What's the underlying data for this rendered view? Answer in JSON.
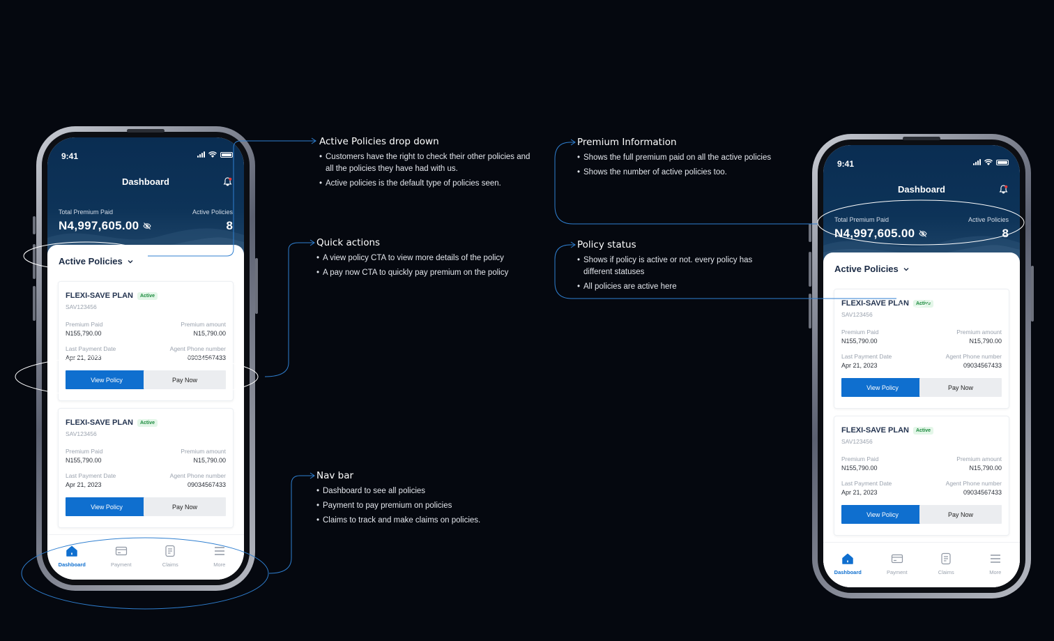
{
  "phone": {
    "status_time": "9:41",
    "title": "Dashboard",
    "total_premium_label": "Total Premium Paid",
    "total_premium_value": "N4,997,605.00",
    "active_policies_label": "Active Policies",
    "active_policies_count": "8",
    "dropdown_label": "Active Policies",
    "policies": [
      {
        "name": "FLEXI-SAVE PLAN",
        "status": "Active",
        "code": "SAV123456",
        "premium_paid_label": "Premium Paid",
        "premium_paid": "N155,790.00",
        "premium_amount_label": "Premium amount",
        "premium_amount": "N15,790.00",
        "last_payment_label": "Last Payment Date",
        "last_payment": "Apr 21, 2023",
        "agent_phone_label": "Agent Phone number",
        "agent_phone": "09034567433",
        "view_label": "View Policy",
        "pay_label": "Pay Now"
      },
      {
        "name": "FLEXI-SAVE PLAN",
        "status": "Active",
        "code": "SAV123456",
        "premium_paid_label": "Premium Paid",
        "premium_paid": "N155,790.00",
        "premium_amount_label": "Premium amount",
        "premium_amount": "N15,790.00",
        "last_payment_label": "Last Payment Date",
        "last_payment": "Apr 21, 2023",
        "agent_phone_label": "Agent Phone number",
        "agent_phone": "09034567433",
        "view_label": "View Policy",
        "pay_label": "Pay Now"
      }
    ],
    "nav": [
      {
        "label": "Dashboard",
        "icon": "home-icon",
        "active": true
      },
      {
        "label": "Payment",
        "icon": "card-icon",
        "active": false
      },
      {
        "label": "Claims",
        "icon": "document-icon",
        "active": false
      },
      {
        "label": "More",
        "icon": "menu-icon",
        "active": false
      }
    ]
  },
  "annotations": {
    "dropdown": {
      "title": "Active Policies drop down",
      "points": [
        "Customers have the right to check their other policies and all the policies they have had with us.",
        "Active policies is the default type of policies seen."
      ]
    },
    "quick_actions": {
      "title": "Quick actions",
      "points": [
        "A view policy CTA to view more details of the policy",
        "A pay now CTA to quickly pay premium on the policy"
      ]
    },
    "nav_bar": {
      "title": "Nav bar",
      "points": [
        "Dashboard to see all policies",
        "Payment to pay premium on policies",
        "Claims to track and make claims on policies."
      ]
    },
    "premium_info": {
      "title": "Premium Information",
      "points": [
        "Shows the full premium paid on all the active policies",
        "Shows the number of active policies too."
      ]
    },
    "policy_status": {
      "title": "Policy status",
      "points": [
        "Shows if policy is active or not. every policy has different statuses",
        "All policies are active here"
      ]
    }
  },
  "colors": {
    "background": "#05080f",
    "header_navy": "#0a2d52",
    "primary_blue": "#0f6fcf",
    "annotation_line": "#2f7fd0",
    "active_green": "#1b8a3d"
  }
}
